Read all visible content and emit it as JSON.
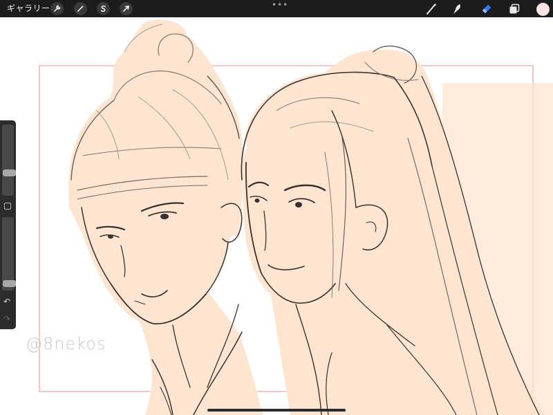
{
  "topbar": {
    "gallery_label": "ギャラリー",
    "left_tools": [
      {
        "name": "wrench-icon",
        "label": "Actions"
      },
      {
        "name": "magic-wand-icon",
        "label": "Adjustments"
      },
      {
        "name": "selection-s-icon",
        "label": "Selection"
      },
      {
        "name": "arrow-cursor-icon",
        "label": "Transform"
      }
    ],
    "right_tools": [
      {
        "name": "brush-icon",
        "label": "Paint",
        "active": false
      },
      {
        "name": "smudge-icon",
        "label": "Smudge",
        "active": false
      },
      {
        "name": "eraser-icon",
        "label": "Erase",
        "active": true
      },
      {
        "name": "layers-icon",
        "label": "Layers",
        "active": false
      }
    ],
    "current_color": "#fbe4e1",
    "accent": "#2f7bf6"
  },
  "canvas": {
    "watermark": "@8nekos",
    "skin_fill": "#fde4cf",
    "line_color": "#3a2f2a",
    "frame_color": "#f6c9c6"
  },
  "sidebar": {
    "brush_size_level": 0.3,
    "opacity_level": 0.05,
    "undo_label": "↶",
    "redo_label": "↷"
  }
}
